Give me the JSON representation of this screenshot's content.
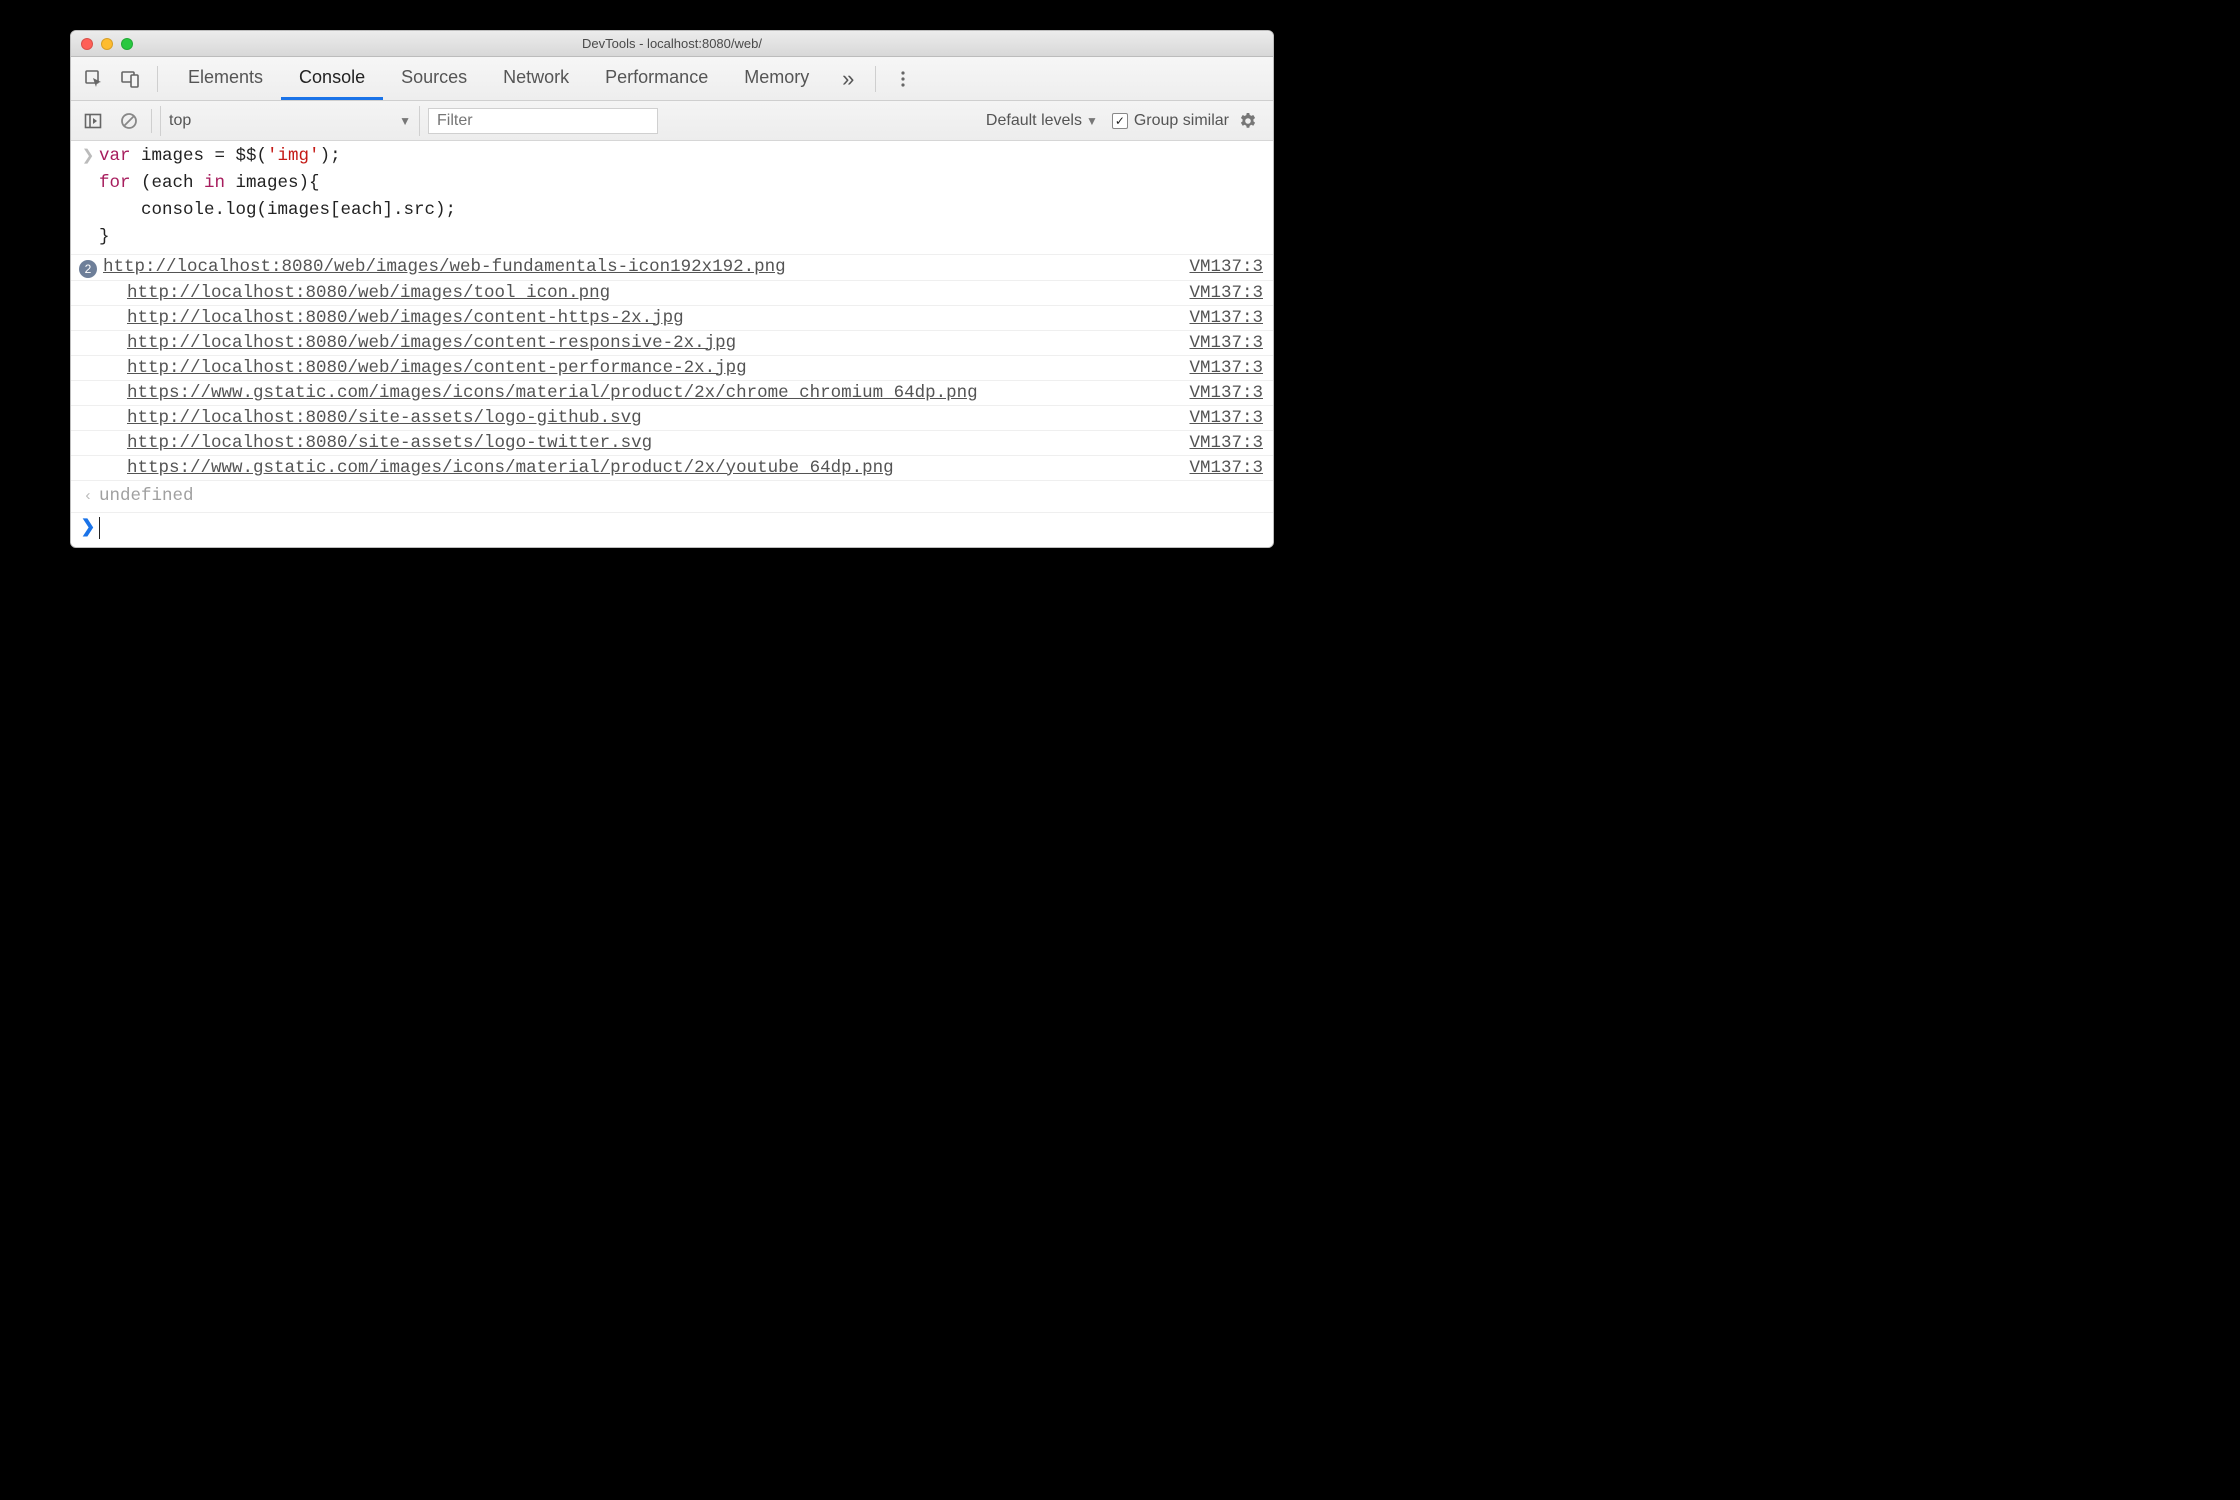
{
  "window": {
    "title": "DevTools - localhost:8080/web/"
  },
  "tabs": {
    "items": [
      "Elements",
      "Console",
      "Sources",
      "Network",
      "Performance",
      "Memory"
    ],
    "active_index": 1
  },
  "filterbar": {
    "context": "top",
    "filter_placeholder": "Filter",
    "levels_label": "Default levels",
    "group_similar_label": "Group similar",
    "group_similar_checked": true
  },
  "input_code": {
    "line1_a": "var",
    "line1_b": " images = $$(",
    "line1_c": "'img'",
    "line1_d": ");",
    "line2_a": "for",
    "line2_b": " (each ",
    "line2_c": "in",
    "line2_d": " images){",
    "line3": "    console.log(images[each].src);",
    "line4": "}"
  },
  "logs": [
    {
      "count": "2",
      "text": "http://localhost:8080/web/images/web-fundamentals-icon192x192.png",
      "source": "VM137:3"
    },
    {
      "count": "",
      "text": "http://localhost:8080/web/images/tool_icon.png",
      "source": "VM137:3"
    },
    {
      "count": "",
      "text": "http://localhost:8080/web/images/content-https-2x.jpg",
      "source": "VM137:3"
    },
    {
      "count": "",
      "text": "http://localhost:8080/web/images/content-responsive-2x.jpg",
      "source": "VM137:3"
    },
    {
      "count": "",
      "text": "http://localhost:8080/web/images/content-performance-2x.jpg",
      "source": "VM137:3"
    },
    {
      "count": "",
      "text": "https://www.gstatic.com/images/icons/material/product/2x/chrome_chromium_64dp.png",
      "source": "VM137:3"
    },
    {
      "count": "",
      "text": "http://localhost:8080/site-assets/logo-github.svg",
      "source": "VM137:3"
    },
    {
      "count": "",
      "text": "http://localhost:8080/site-assets/logo-twitter.svg",
      "source": "VM137:3"
    },
    {
      "count": "",
      "text": "https://www.gstatic.com/images/icons/material/product/2x/youtube_64dp.png",
      "source": "VM137:3"
    }
  ],
  "return_value": "undefined"
}
